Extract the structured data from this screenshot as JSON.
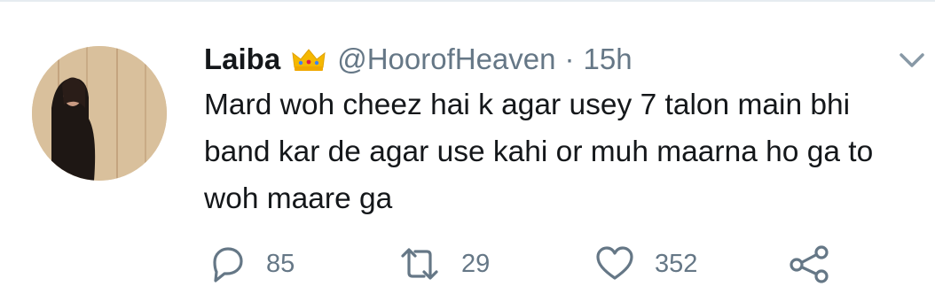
{
  "tweet": {
    "display_name": "Laiba",
    "badge_icon": "crown-emoji",
    "handle": "@HoorofHeaven",
    "separator": "·",
    "timestamp": "15h",
    "text": "Mard woh cheez hai k agar usey 7 talon main bhi band kar de agar use kahi or muh maarna ho ga to woh maare ga"
  },
  "actions": {
    "reply": {
      "icon": "reply-icon",
      "count": "85"
    },
    "retweet": {
      "icon": "retweet-icon",
      "count": "29"
    },
    "like": {
      "icon": "heart-icon",
      "count": "352"
    },
    "share": {
      "icon": "share-icon"
    }
  },
  "menu": {
    "icon": "chevron-down-icon"
  },
  "colors": {
    "text": "#14171a",
    "secondary": "#657786",
    "crown": "#f5b800",
    "divider": "#e6ecf0"
  }
}
